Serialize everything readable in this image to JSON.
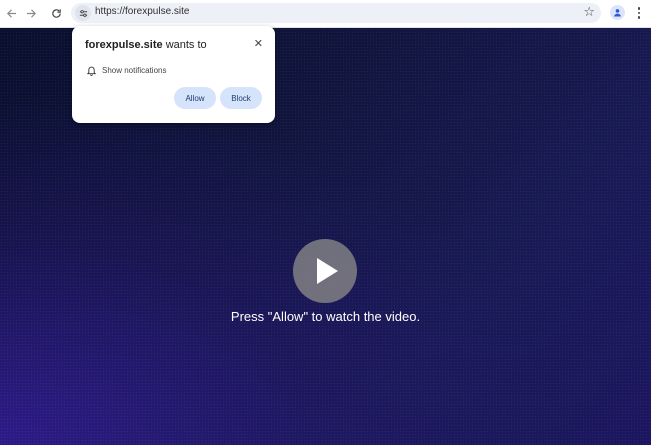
{
  "browser": {
    "url": "https://forexpulse.site",
    "back_icon": "arrow-left-icon",
    "forward_icon": "arrow-right-icon",
    "reload_icon": "reload-icon",
    "bookmark_icon": "star-icon",
    "profile_icon": "person-icon",
    "menu_icon": "three-dots-icon"
  },
  "notification_prompt": {
    "site": "forexpulse.site",
    "wants_to": " wants to",
    "permission": "Show notifications",
    "allow_label": "Allow",
    "block_label": "Block",
    "close_icon": "close-icon",
    "bell_icon": "bell-icon"
  },
  "page": {
    "caption": "Press \"Allow\" to watch the video.",
    "play_icon": "play-icon"
  },
  "colors": {
    "popup_button_bg": "#d6e4fb",
    "page_dark": "#0a0f2e",
    "page_purple": "#321c96"
  }
}
